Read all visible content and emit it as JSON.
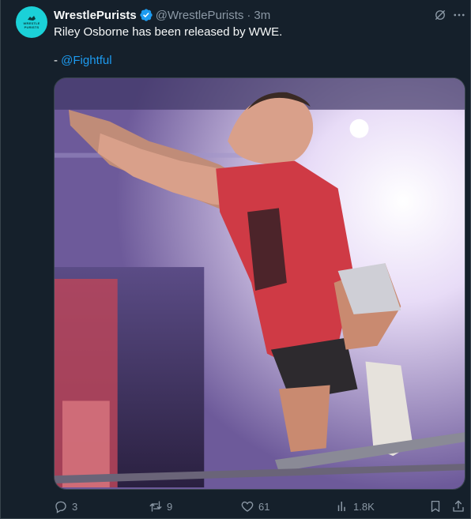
{
  "author": {
    "display_name": "WrestlePurists",
    "handle": "@WrestlePurists",
    "separator": "·",
    "timestamp": "3m",
    "avatar_text": "WRESTLE PURISTS",
    "avatar_color": "#1bd1d8",
    "verified_color": "#1d9bf0"
  },
  "tweet": {
    "text": "Riley Osborne has been released by WWE.",
    "credit_prefix": "- ",
    "credit_mention": "@Fightful"
  },
  "media": {
    "icon": "photo-wrestler-on-turnbuckle"
  },
  "actions": {
    "replies": "3",
    "reposts": "9",
    "likes": "61",
    "views": "1.8K"
  },
  "colors": {
    "background": "#15202b",
    "secondary_text": "#8b98a5",
    "link": "#1d9bf0"
  }
}
